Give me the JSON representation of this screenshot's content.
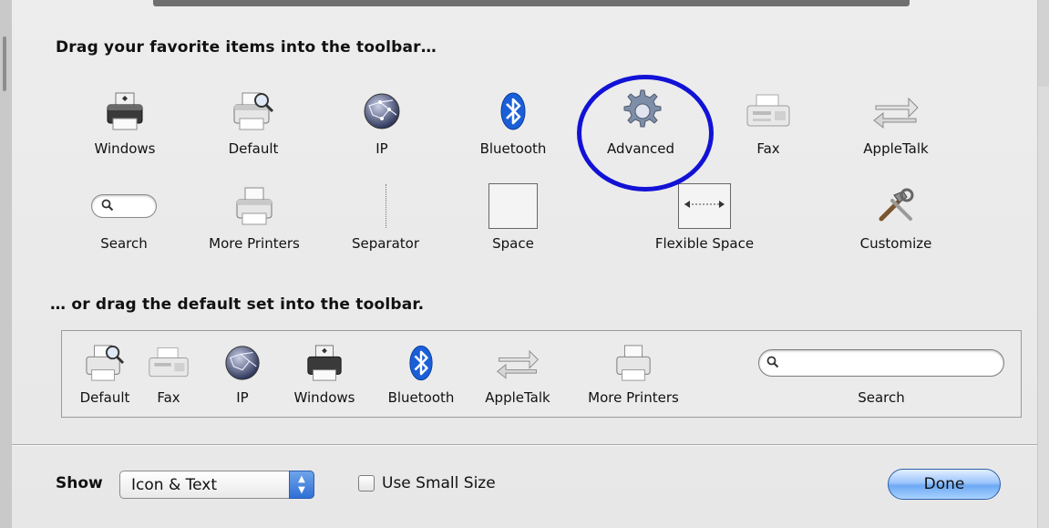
{
  "sheet": {
    "heading_top": "Drag your favorite items into the toolbar…",
    "heading_bottom": "… or drag the default set into the toolbar."
  },
  "palette_items": [
    {
      "label": "Windows",
      "icon": "windows-printer-icon"
    },
    {
      "label": "Default",
      "icon": "default-printer-icon"
    },
    {
      "label": "IP",
      "icon": "ip-globe-icon"
    },
    {
      "label": "Bluetooth",
      "icon": "bluetooth-icon"
    },
    {
      "label": "Advanced",
      "icon": "gear-icon"
    },
    {
      "label": "Fax",
      "icon": "fax-icon"
    },
    {
      "label": "AppleTalk",
      "icon": "appletalk-icon"
    },
    {
      "label": "Search",
      "icon": "search-field-icon"
    },
    {
      "label": "More Printers",
      "icon": "printer-icon"
    },
    {
      "label": "Separator",
      "icon": "separator-icon"
    },
    {
      "label": "Space",
      "icon": "space-icon"
    },
    {
      "label": "Flexible Space",
      "icon": "flexible-space-icon"
    },
    {
      "label": "Customize",
      "icon": "tools-icon"
    }
  ],
  "default_set": [
    {
      "label": "Default",
      "icon": "default-printer-icon"
    },
    {
      "label": "Fax",
      "icon": "fax-icon"
    },
    {
      "label": "IP",
      "icon": "ip-globe-icon"
    },
    {
      "label": "Windows",
      "icon": "windows-printer-icon"
    },
    {
      "label": "Bluetooth",
      "icon": "bluetooth-icon"
    },
    {
      "label": "AppleTalk",
      "icon": "appletalk-icon"
    },
    {
      "label": "More Printers",
      "icon": "printer-icon"
    },
    {
      "label": "Search",
      "icon": "search-field-icon"
    }
  ],
  "footer": {
    "show_label": "Show",
    "show_value": "Icon & Text",
    "small_size_label": "Use Small Size",
    "small_size_checked": false,
    "done_label": "Done"
  },
  "colors": {
    "highlight_ring": "#1212d6",
    "bluetooth_blue": "#1a5fd8",
    "done_button": "#6da9f4"
  }
}
